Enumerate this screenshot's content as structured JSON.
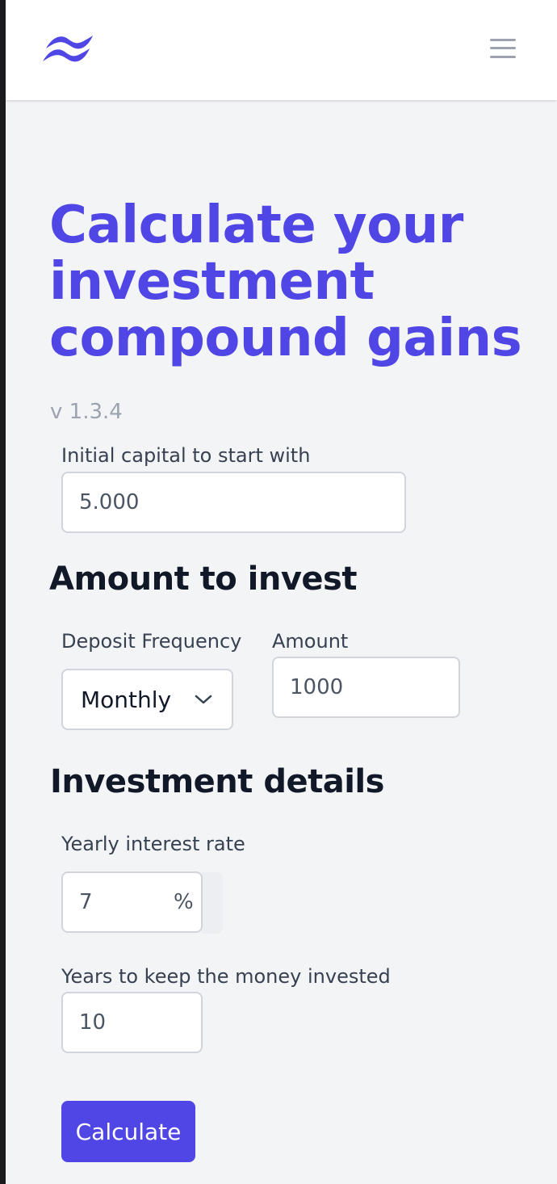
{
  "brand": {
    "logo_icon": "tailwind-waves-icon",
    "accent_color": "#4f46e5"
  },
  "nav": {
    "menu_icon": "hamburger-menu-icon"
  },
  "hero": {
    "title": "Calculate your investment compound gains",
    "version": "v 1.3.4"
  },
  "initial_capital": {
    "label": "Initial capital to start with",
    "value": "5.000"
  },
  "amount_section": {
    "heading": "Amount to invest",
    "frequency_label": "Deposit Frequency",
    "frequency_value": "Monthly",
    "frequency_icon": "chevron-down-icon",
    "amount_label": "Amount",
    "amount_value": "1000"
  },
  "details_section": {
    "heading": "Investment details",
    "rate_label": "Yearly interest rate",
    "rate_value": "7",
    "rate_suffix": "%",
    "years_label": "Years to keep the money invested",
    "years_value": "10"
  },
  "actions": {
    "calculate_label": "Calculate"
  }
}
